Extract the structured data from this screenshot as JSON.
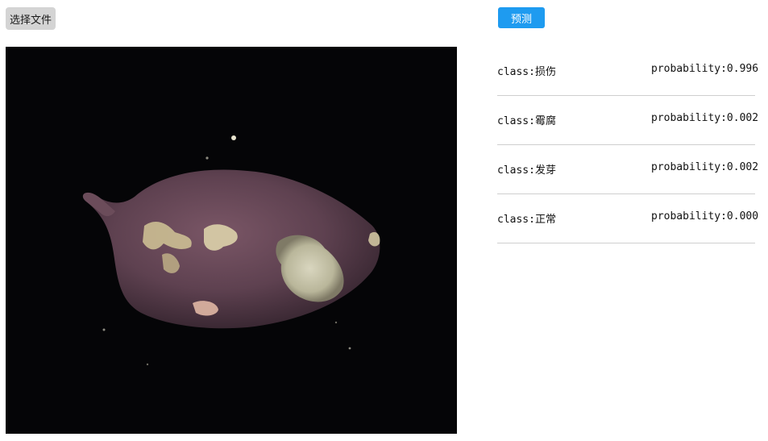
{
  "toolbar": {
    "choose_file_label": "选择文件",
    "predict_label": "预测"
  },
  "preview": {
    "subject": "sweet-potato-photo"
  },
  "results": [
    {
      "class_text": "class:损伤",
      "prob_text": "probability:0.996"
    },
    {
      "class_text": "class:霉腐",
      "prob_text": "probability:0.002"
    },
    {
      "class_text": "class:发芽",
      "prob_text": "probability:0.002"
    },
    {
      "class_text": "class:正常",
      "prob_text": "probability:0.000"
    }
  ],
  "colors": {
    "predict_button": "#1e9bf0",
    "choose_button": "#d4d4d4",
    "preview_background": "#050507",
    "divider": "#cfcfcf"
  }
}
